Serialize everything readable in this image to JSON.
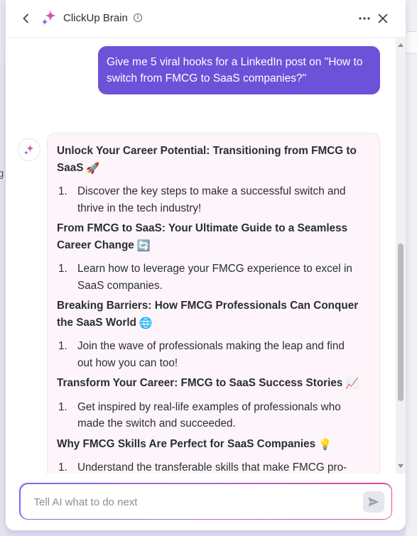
{
  "header": {
    "title": "ClickUp Brain",
    "info_icon": "i",
    "icons": {
      "back": "chevron-left-icon",
      "logo": "clickup-brain-sparkle-icon",
      "info": "info-icon",
      "more": "more-horizontal-icon",
      "close": "close-icon"
    }
  },
  "conversation": {
    "user_message": "Give me 5 viral hooks for a LinkedIn post on \"How to switch from FMCG to SaaS companies?\"",
    "ai_response": {
      "hooks": [
        {
          "title": "Unlock Your Career Potential: Transitioning from FMCG to SaaS",
          "emoji": "🚀",
          "number": "1.",
          "item": "Discover the key steps to make a successful switch and thrive in the tech industry!"
        },
        {
          "title": "From FMCG to SaaS: Your Ultimate Guide to a Seamless Career Change",
          "emoji": "🔄",
          "number": "1.",
          "item": "Learn how to leverage your FMCG experience to excel in SaaS companies."
        },
        {
          "title": "Breaking Barriers: How FMCG Professionals Can Conquer the SaaS World",
          "emoji": "🌐",
          "number": "1.",
          "item": "Join the wave of professionals making the leap and find out how you can too!"
        },
        {
          "title": "Transform Your Career: FMCG to SaaS Success Stories",
          "emoji": "📈",
          "number": "1.",
          "item": "Get inspired by real-life examples of professionals who made the switch and succeeded."
        },
        {
          "title": "Why FMCG Skills Are Perfect for SaaS Companies",
          "emoji": "💡",
          "number": "1.",
          "item": "Understand the transferable skills that make FMCG pro-"
        }
      ]
    }
  },
  "composer": {
    "placeholder": "Tell AI what to do next",
    "value": ""
  },
  "background": {
    "partial_text": "g"
  },
  "colors": {
    "user_bubble": "#6b52d9",
    "ai_bubble": "#fdf5fa",
    "accent_gradient_start": "#7b68ee",
    "accent_gradient_end": "#e5479a"
  }
}
